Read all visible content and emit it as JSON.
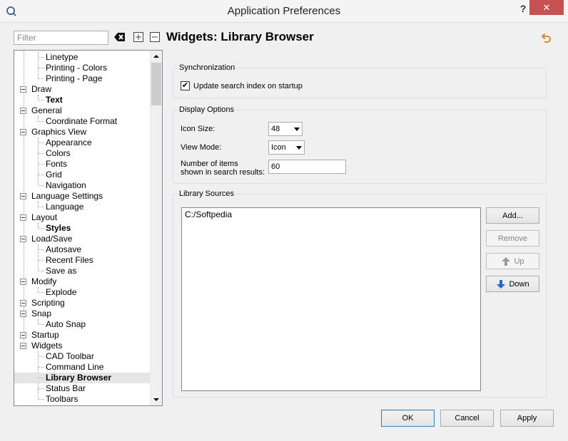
{
  "window": {
    "title": "Application Preferences",
    "help_glyph": "?",
    "close_glyph": "✕"
  },
  "filter": {
    "placeholder": "Filter",
    "value": ""
  },
  "tree": {
    "items": [
      {
        "label": "Linetype",
        "level": 1,
        "bold": false
      },
      {
        "label": "Printing - Colors",
        "level": 1,
        "bold": false
      },
      {
        "label": "Printing - Page",
        "level": 1,
        "bold": false
      },
      {
        "label": "Draw",
        "level": 0,
        "bold": false
      },
      {
        "label": "Text",
        "level": 1,
        "bold": true
      },
      {
        "label": "General",
        "level": 0,
        "bold": false
      },
      {
        "label": "Coordinate Format",
        "level": 1,
        "bold": false
      },
      {
        "label": "Graphics View",
        "level": 0,
        "bold": false
      },
      {
        "label": "Appearance",
        "level": 1,
        "bold": false
      },
      {
        "label": "Colors",
        "level": 1,
        "bold": false
      },
      {
        "label": "Fonts",
        "level": 1,
        "bold": false
      },
      {
        "label": "Grid",
        "level": 1,
        "bold": false
      },
      {
        "label": "Navigation",
        "level": 1,
        "bold": false
      },
      {
        "label": "Language Settings",
        "level": 0,
        "bold": false
      },
      {
        "label": "Language",
        "level": 1,
        "bold": false
      },
      {
        "label": "Layout",
        "level": 0,
        "bold": false
      },
      {
        "label": "Styles",
        "level": 1,
        "bold": true
      },
      {
        "label": "Load/Save",
        "level": 0,
        "bold": false
      },
      {
        "label": "Autosave",
        "level": 1,
        "bold": false
      },
      {
        "label": "Recent Files",
        "level": 1,
        "bold": false
      },
      {
        "label": "Save as",
        "level": 1,
        "bold": false
      },
      {
        "label": "Modify",
        "level": 0,
        "bold": false
      },
      {
        "label": "Explode",
        "level": 1,
        "bold": false
      },
      {
        "label": "Scripting",
        "level": 0,
        "bold": false
      },
      {
        "label": "Snap",
        "level": 0,
        "bold": false
      },
      {
        "label": "Auto Snap",
        "level": 1,
        "bold": false
      },
      {
        "label": "Startup",
        "level": 0,
        "bold": false
      },
      {
        "label": "Widgets",
        "level": 0,
        "bold": false
      },
      {
        "label": "CAD Toolbar",
        "level": 1,
        "bold": false
      },
      {
        "label": "Command Line",
        "level": 1,
        "bold": false
      },
      {
        "label": "Library Browser",
        "level": 1,
        "bold": true,
        "selected": true
      },
      {
        "label": "Status Bar",
        "level": 1,
        "bold": false
      },
      {
        "label": "Toolbars",
        "level": 1,
        "bold": false
      }
    ]
  },
  "page": {
    "title": "Widgets: Library Browser"
  },
  "sync": {
    "legend": "Synchronization",
    "update_label": "Update search index on startup",
    "update_checked": true,
    "check_glyph": "✔"
  },
  "display": {
    "legend": "Display Options",
    "icon_size_label": "Icon Size:",
    "icon_size_value": "48",
    "view_mode_label": "View Mode:",
    "view_mode_value": "Icon",
    "num_items_label_1": "Number of items",
    "num_items_label_2": "shown in search results:",
    "num_items_value": "60"
  },
  "sources": {
    "legend": "Library Sources",
    "items": [
      "C:/Softpedia"
    ],
    "add_label": "Add...",
    "remove_label": "Remove",
    "up_label": "Up",
    "down_label": "Down"
  },
  "footer": {
    "ok_label": "OK",
    "cancel_label": "Cancel",
    "apply_label": "Apply"
  },
  "colors": {
    "close_button": "#c75050",
    "selection": "#e5e5e5",
    "default_button_border": "#3c7fb1"
  }
}
